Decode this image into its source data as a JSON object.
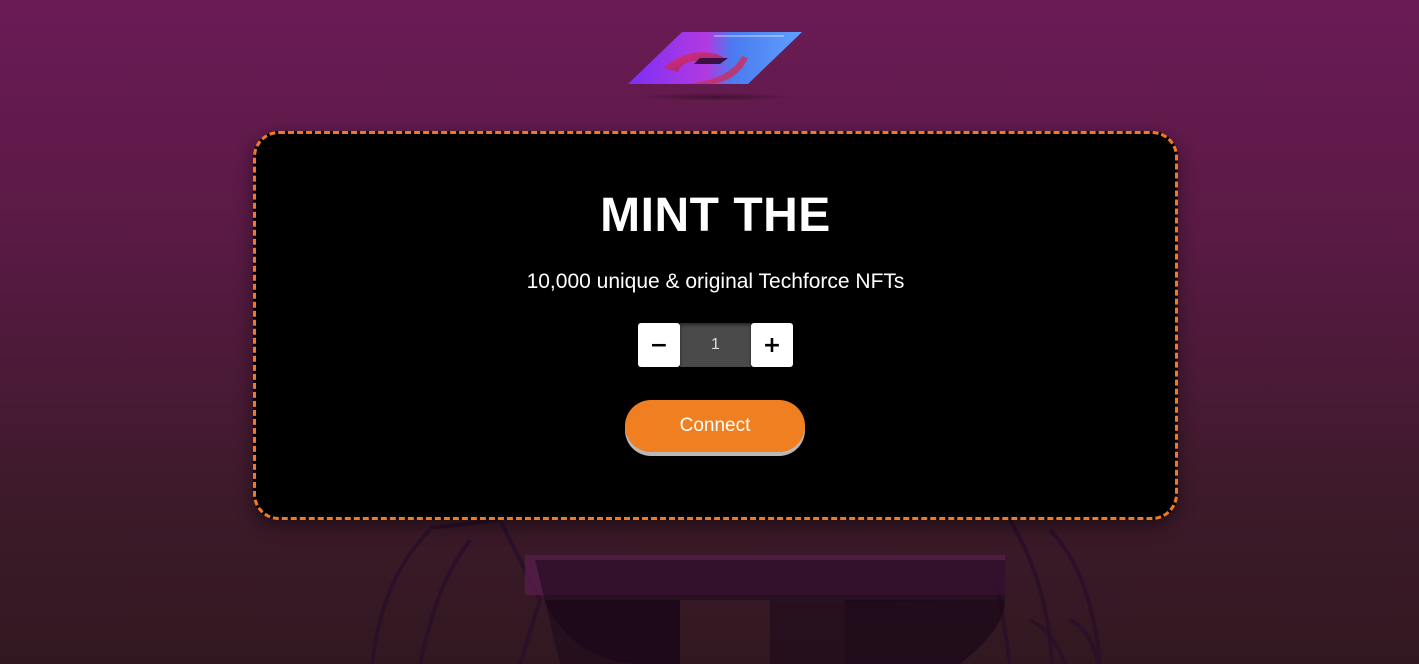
{
  "header": {
    "logo_icon": "techforce-logo-icon"
  },
  "mint": {
    "title": "MINT THE",
    "subtitle": "10,000 unique & original Techforce NFTs",
    "decrement_label": "−",
    "increment_label": "+",
    "quantity": "1",
    "connect_label": "Connect"
  },
  "colors": {
    "accent": "#f07f22",
    "card_border": "#f07a22",
    "background_top": "#6a1b55",
    "background_bottom": "#311820",
    "card": "#000000"
  },
  "background": {
    "art_icon": "robot-character-illustration"
  }
}
